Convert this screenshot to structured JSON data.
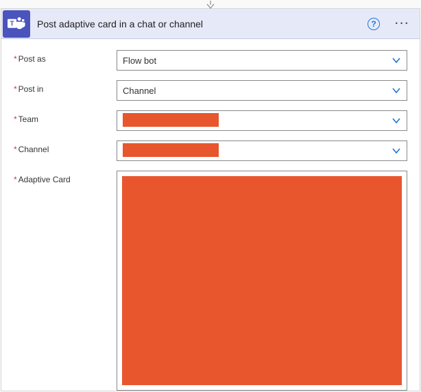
{
  "header": {
    "title": "Post adaptive card in a chat or channel",
    "help_glyph": "?",
    "menu_glyph": "···"
  },
  "fields": {
    "postAs": {
      "label": "Post as",
      "value": "Flow bot"
    },
    "postIn": {
      "label": "Post in",
      "value": "Channel"
    },
    "team": {
      "label": "Team",
      "value": ""
    },
    "channel": {
      "label": "Channel",
      "value": ""
    },
    "adaptiveCard": {
      "label": "Adaptive Card",
      "value": ""
    }
  },
  "colors": {
    "teamsPurple": "#4b53bc",
    "accentBlue": "#1f74db",
    "redacted": "#e8562d"
  }
}
